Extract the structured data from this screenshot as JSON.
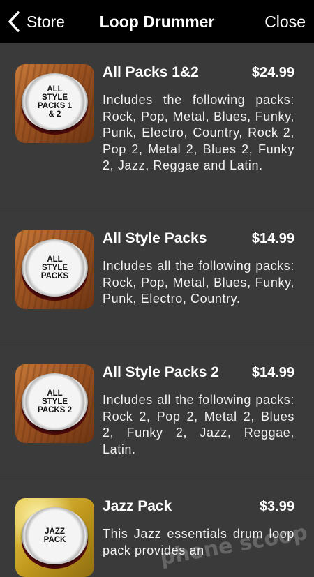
{
  "navbar": {
    "back_label": "Store",
    "title": "Loop Drummer",
    "close_label": "Close"
  },
  "packs": [
    {
      "thumb_text": "ALL STYLE PACKS 1 & 2",
      "thumb_style": "wood",
      "title": "All Packs 1&2",
      "price": "$24.99",
      "description": "Includes the following packs: Rock, Pop, Metal, Blues, Funky, Punk, Electro, Country, Rock 2, Pop 2, Metal 2, Blues 2, Funky 2, Jazz, Reggae and Latin."
    },
    {
      "thumb_text": "ALL STYLE PACKS",
      "thumb_style": "wood",
      "title": "All Style Packs",
      "price": "$14.99",
      "description": "Includes all the following packs: Rock, Pop, Metal, Blues, Funky, Punk, Electro, Country."
    },
    {
      "thumb_text": "ALL STYLE PACKS 2",
      "thumb_style": "wood",
      "title": "All Style Packs 2",
      "price": "$14.99",
      "description": "Includes all the following packs: Rock 2, Pop 2, Metal 2, Blues 2, Funky 2, Jazz, Reggae, Latin."
    },
    {
      "thumb_text": "JAZZ PACK",
      "thumb_style": "gold",
      "title": "Jazz Pack",
      "price": "$3.99",
      "description": "This Jazz essentials drum loop pack provides an"
    }
  ],
  "watermark": "phone scoop",
  "icons": {
    "back": "chevron-left-icon"
  },
  "colors": {
    "navbar_bg": "#000000",
    "list_bg": "#3a3a3a",
    "separator": "#555555"
  }
}
